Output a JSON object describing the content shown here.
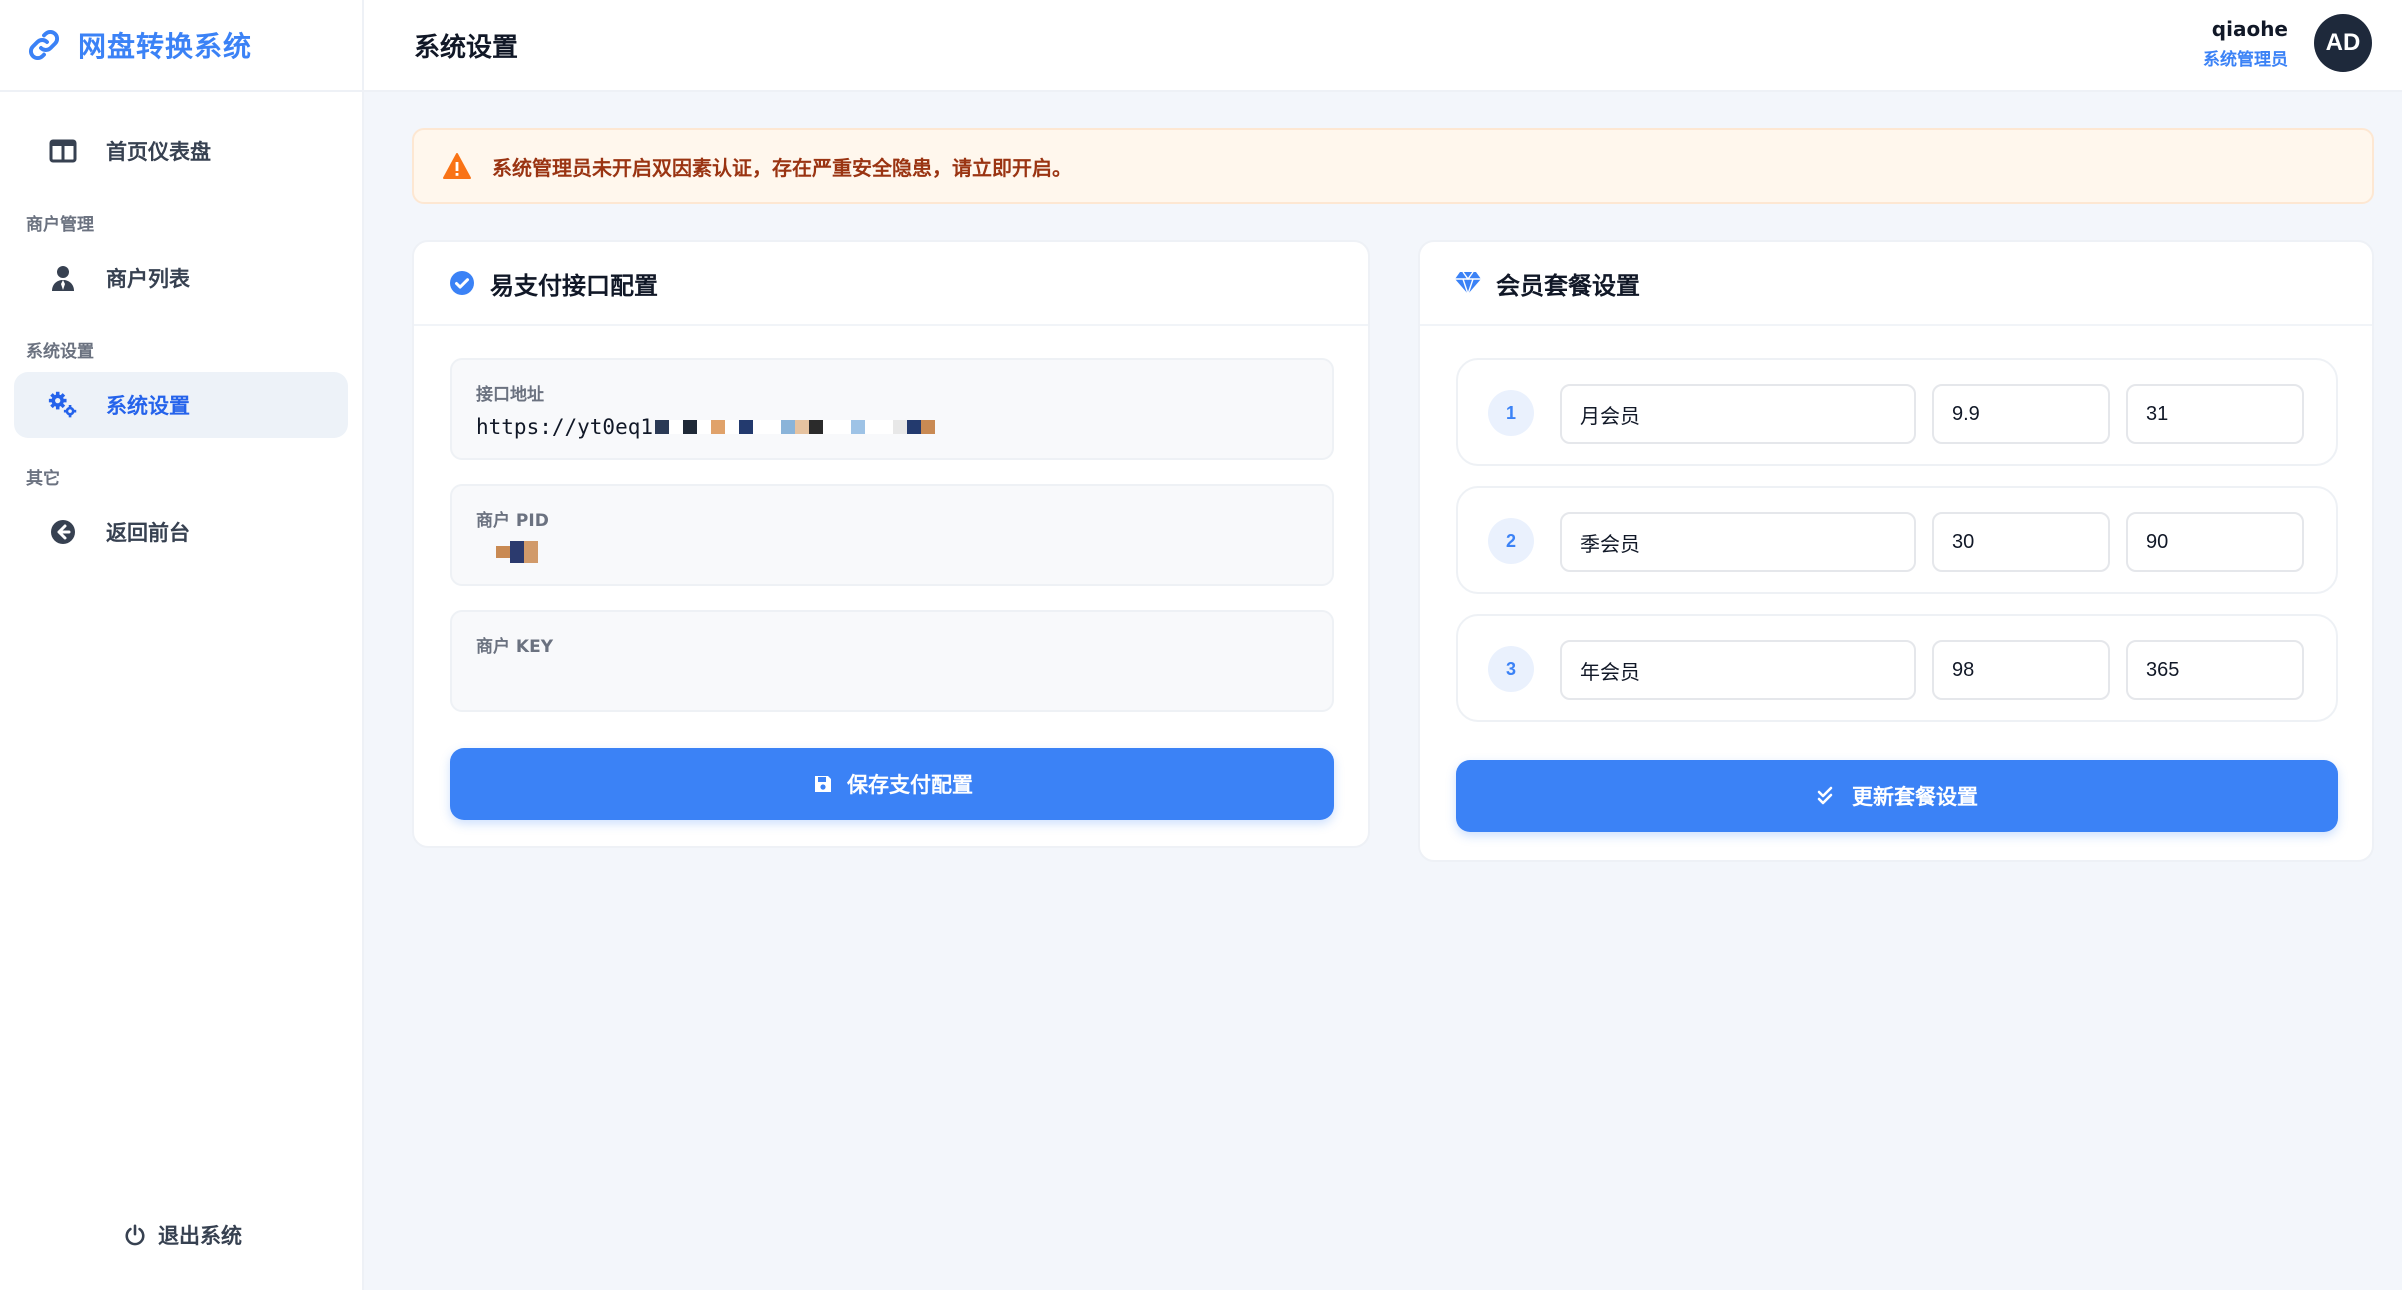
{
  "brand": {
    "title": "网盘转换系统",
    "icon": "link-icon",
    "color": "#3b82f6"
  },
  "sidebar": {
    "items": [
      {
        "label": "首页仪表盘",
        "icon": "columns-icon"
      },
      {
        "group": "商户管理"
      },
      {
        "label": "商户列表",
        "icon": "user-tie-icon"
      },
      {
        "group": "系统设置"
      },
      {
        "label": "系统设置",
        "icon": "cogs-icon",
        "active": true
      },
      {
        "group": "其它"
      },
      {
        "label": "返回前台",
        "icon": "arrow-circle-left-icon"
      }
    ],
    "logout_label": "退出系统"
  },
  "header": {
    "title": "系统设置"
  },
  "user": {
    "name": "qiaohe",
    "role": "系统管理员",
    "avatar_initials": "AD"
  },
  "alert": {
    "text": "系统管理员未开启双因素认证，存在严重安全隐患，请立即开启。",
    "color": "#9a3412"
  },
  "pay": {
    "title": "易支付接口配置",
    "fields": [
      {
        "label": "接口地址",
        "value": "https://yt0eq1"
      },
      {
        "label": "商户 PID",
        "value": ""
      },
      {
        "label": "商户 KEY",
        "value": ""
      }
    ],
    "save_label": "保存支付配置"
  },
  "plans": {
    "title": "会员套餐设置",
    "rows": [
      {
        "index": "1",
        "name": "月会员",
        "price": "9.9",
        "days": "31"
      },
      {
        "index": "2",
        "name": "季会员",
        "price": "30",
        "days": "90"
      },
      {
        "index": "3",
        "name": "年会员",
        "price": "98",
        "days": "365"
      }
    ],
    "update_label": "更新套餐设置"
  },
  "colors": {
    "accent": "#3b82f6",
    "alert_bg": "#fff7ed",
    "page_bg": "#f3f6fb"
  }
}
